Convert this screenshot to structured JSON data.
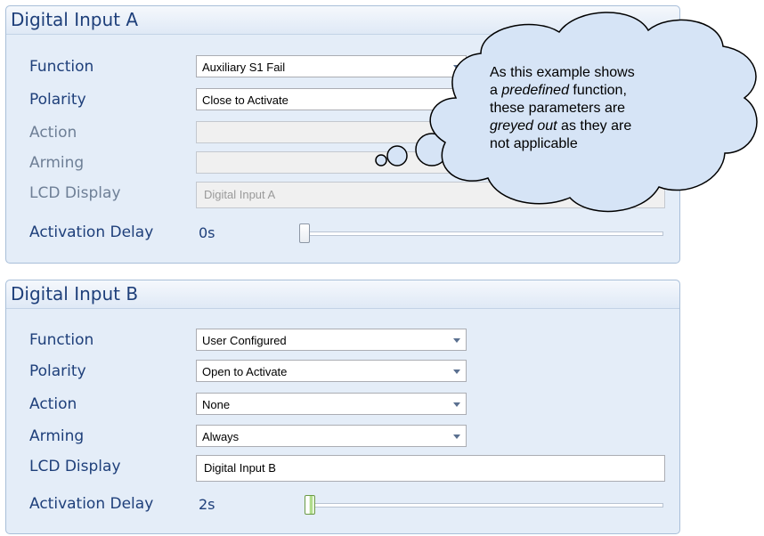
{
  "panelA": {
    "title": "Digital Input A",
    "function": {
      "label": "Function",
      "value": "Auxiliary S1 Fail"
    },
    "polarity": {
      "label": "Polarity",
      "value": "Close to Activate"
    },
    "action": {
      "label": "Action",
      "value": ""
    },
    "arming": {
      "label": "Arming",
      "value": ""
    },
    "lcd": {
      "label": "LCD Display",
      "value": "Digital Input A"
    },
    "delay": {
      "label": "Activation Delay",
      "value": "0s",
      "level": 0
    }
  },
  "panelB": {
    "title": "Digital Input B",
    "function": {
      "label": "Function",
      "value": "User Configured"
    },
    "polarity": {
      "label": "Polarity",
      "value": "Open to Activate"
    },
    "action": {
      "label": "Action",
      "value": "None"
    },
    "arming": {
      "label": "Arming",
      "value": "Always"
    },
    "lcd": {
      "label": "LCD Display",
      "value": "Digital Input B"
    },
    "delay": {
      "label": "Activation Delay",
      "value": "2s",
      "level": 2
    }
  },
  "callout": {
    "line1": "As this example shows",
    "line2_pre": "a ",
    "line2_em": "predefined",
    "line2_post": " function,",
    "line3": "these parameters are",
    "line4_em": "greyed out",
    "line4_post": " as they are",
    "line5": "not applicable"
  },
  "colors": {
    "panel_bg": "#e4edf8",
    "label_text": "#1e3f7a",
    "disabled_label": "#6e7f96",
    "cloud_fill": "#d6e4f6"
  },
  "icons": [
    "chevron-down-icon",
    "slider-thumb"
  ]
}
